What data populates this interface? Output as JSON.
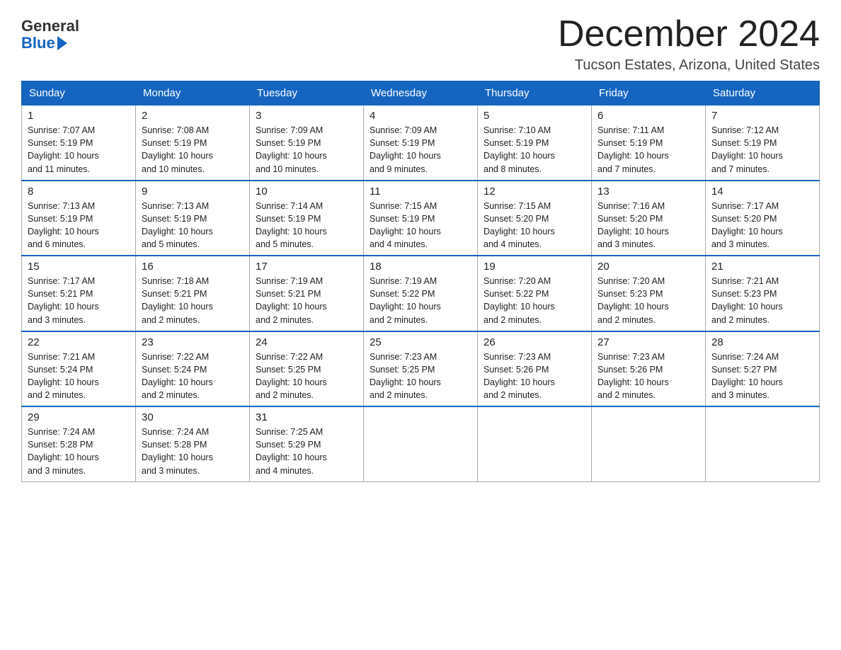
{
  "header": {
    "logo_general": "General",
    "logo_blue": "Blue",
    "month_year": "December 2024",
    "location": "Tucson Estates, Arizona, United States"
  },
  "weekdays": [
    "Sunday",
    "Monday",
    "Tuesday",
    "Wednesday",
    "Thursday",
    "Friday",
    "Saturday"
  ],
  "weeks": [
    [
      {
        "day": "1",
        "info": "Sunrise: 7:07 AM\nSunset: 5:19 PM\nDaylight: 10 hours\nand 11 minutes."
      },
      {
        "day": "2",
        "info": "Sunrise: 7:08 AM\nSunset: 5:19 PM\nDaylight: 10 hours\nand 10 minutes."
      },
      {
        "day": "3",
        "info": "Sunrise: 7:09 AM\nSunset: 5:19 PM\nDaylight: 10 hours\nand 10 minutes."
      },
      {
        "day": "4",
        "info": "Sunrise: 7:09 AM\nSunset: 5:19 PM\nDaylight: 10 hours\nand 9 minutes."
      },
      {
        "day": "5",
        "info": "Sunrise: 7:10 AM\nSunset: 5:19 PM\nDaylight: 10 hours\nand 8 minutes."
      },
      {
        "day": "6",
        "info": "Sunrise: 7:11 AM\nSunset: 5:19 PM\nDaylight: 10 hours\nand 7 minutes."
      },
      {
        "day": "7",
        "info": "Sunrise: 7:12 AM\nSunset: 5:19 PM\nDaylight: 10 hours\nand 7 minutes."
      }
    ],
    [
      {
        "day": "8",
        "info": "Sunrise: 7:13 AM\nSunset: 5:19 PM\nDaylight: 10 hours\nand 6 minutes."
      },
      {
        "day": "9",
        "info": "Sunrise: 7:13 AM\nSunset: 5:19 PM\nDaylight: 10 hours\nand 5 minutes."
      },
      {
        "day": "10",
        "info": "Sunrise: 7:14 AM\nSunset: 5:19 PM\nDaylight: 10 hours\nand 5 minutes."
      },
      {
        "day": "11",
        "info": "Sunrise: 7:15 AM\nSunset: 5:19 PM\nDaylight: 10 hours\nand 4 minutes."
      },
      {
        "day": "12",
        "info": "Sunrise: 7:15 AM\nSunset: 5:20 PM\nDaylight: 10 hours\nand 4 minutes."
      },
      {
        "day": "13",
        "info": "Sunrise: 7:16 AM\nSunset: 5:20 PM\nDaylight: 10 hours\nand 3 minutes."
      },
      {
        "day": "14",
        "info": "Sunrise: 7:17 AM\nSunset: 5:20 PM\nDaylight: 10 hours\nand 3 minutes."
      }
    ],
    [
      {
        "day": "15",
        "info": "Sunrise: 7:17 AM\nSunset: 5:21 PM\nDaylight: 10 hours\nand 3 minutes."
      },
      {
        "day": "16",
        "info": "Sunrise: 7:18 AM\nSunset: 5:21 PM\nDaylight: 10 hours\nand 2 minutes."
      },
      {
        "day": "17",
        "info": "Sunrise: 7:19 AM\nSunset: 5:21 PM\nDaylight: 10 hours\nand 2 minutes."
      },
      {
        "day": "18",
        "info": "Sunrise: 7:19 AM\nSunset: 5:22 PM\nDaylight: 10 hours\nand 2 minutes."
      },
      {
        "day": "19",
        "info": "Sunrise: 7:20 AM\nSunset: 5:22 PM\nDaylight: 10 hours\nand 2 minutes."
      },
      {
        "day": "20",
        "info": "Sunrise: 7:20 AM\nSunset: 5:23 PM\nDaylight: 10 hours\nand 2 minutes."
      },
      {
        "day": "21",
        "info": "Sunrise: 7:21 AM\nSunset: 5:23 PM\nDaylight: 10 hours\nand 2 minutes."
      }
    ],
    [
      {
        "day": "22",
        "info": "Sunrise: 7:21 AM\nSunset: 5:24 PM\nDaylight: 10 hours\nand 2 minutes."
      },
      {
        "day": "23",
        "info": "Sunrise: 7:22 AM\nSunset: 5:24 PM\nDaylight: 10 hours\nand 2 minutes."
      },
      {
        "day": "24",
        "info": "Sunrise: 7:22 AM\nSunset: 5:25 PM\nDaylight: 10 hours\nand 2 minutes."
      },
      {
        "day": "25",
        "info": "Sunrise: 7:23 AM\nSunset: 5:25 PM\nDaylight: 10 hours\nand 2 minutes."
      },
      {
        "day": "26",
        "info": "Sunrise: 7:23 AM\nSunset: 5:26 PM\nDaylight: 10 hours\nand 2 minutes."
      },
      {
        "day": "27",
        "info": "Sunrise: 7:23 AM\nSunset: 5:26 PM\nDaylight: 10 hours\nand 2 minutes."
      },
      {
        "day": "28",
        "info": "Sunrise: 7:24 AM\nSunset: 5:27 PM\nDaylight: 10 hours\nand 3 minutes."
      }
    ],
    [
      {
        "day": "29",
        "info": "Sunrise: 7:24 AM\nSunset: 5:28 PM\nDaylight: 10 hours\nand 3 minutes."
      },
      {
        "day": "30",
        "info": "Sunrise: 7:24 AM\nSunset: 5:28 PM\nDaylight: 10 hours\nand 3 minutes."
      },
      {
        "day": "31",
        "info": "Sunrise: 7:25 AM\nSunset: 5:29 PM\nDaylight: 10 hours\nand 4 minutes."
      },
      {
        "day": "",
        "info": ""
      },
      {
        "day": "",
        "info": ""
      },
      {
        "day": "",
        "info": ""
      },
      {
        "day": "",
        "info": ""
      }
    ]
  ]
}
